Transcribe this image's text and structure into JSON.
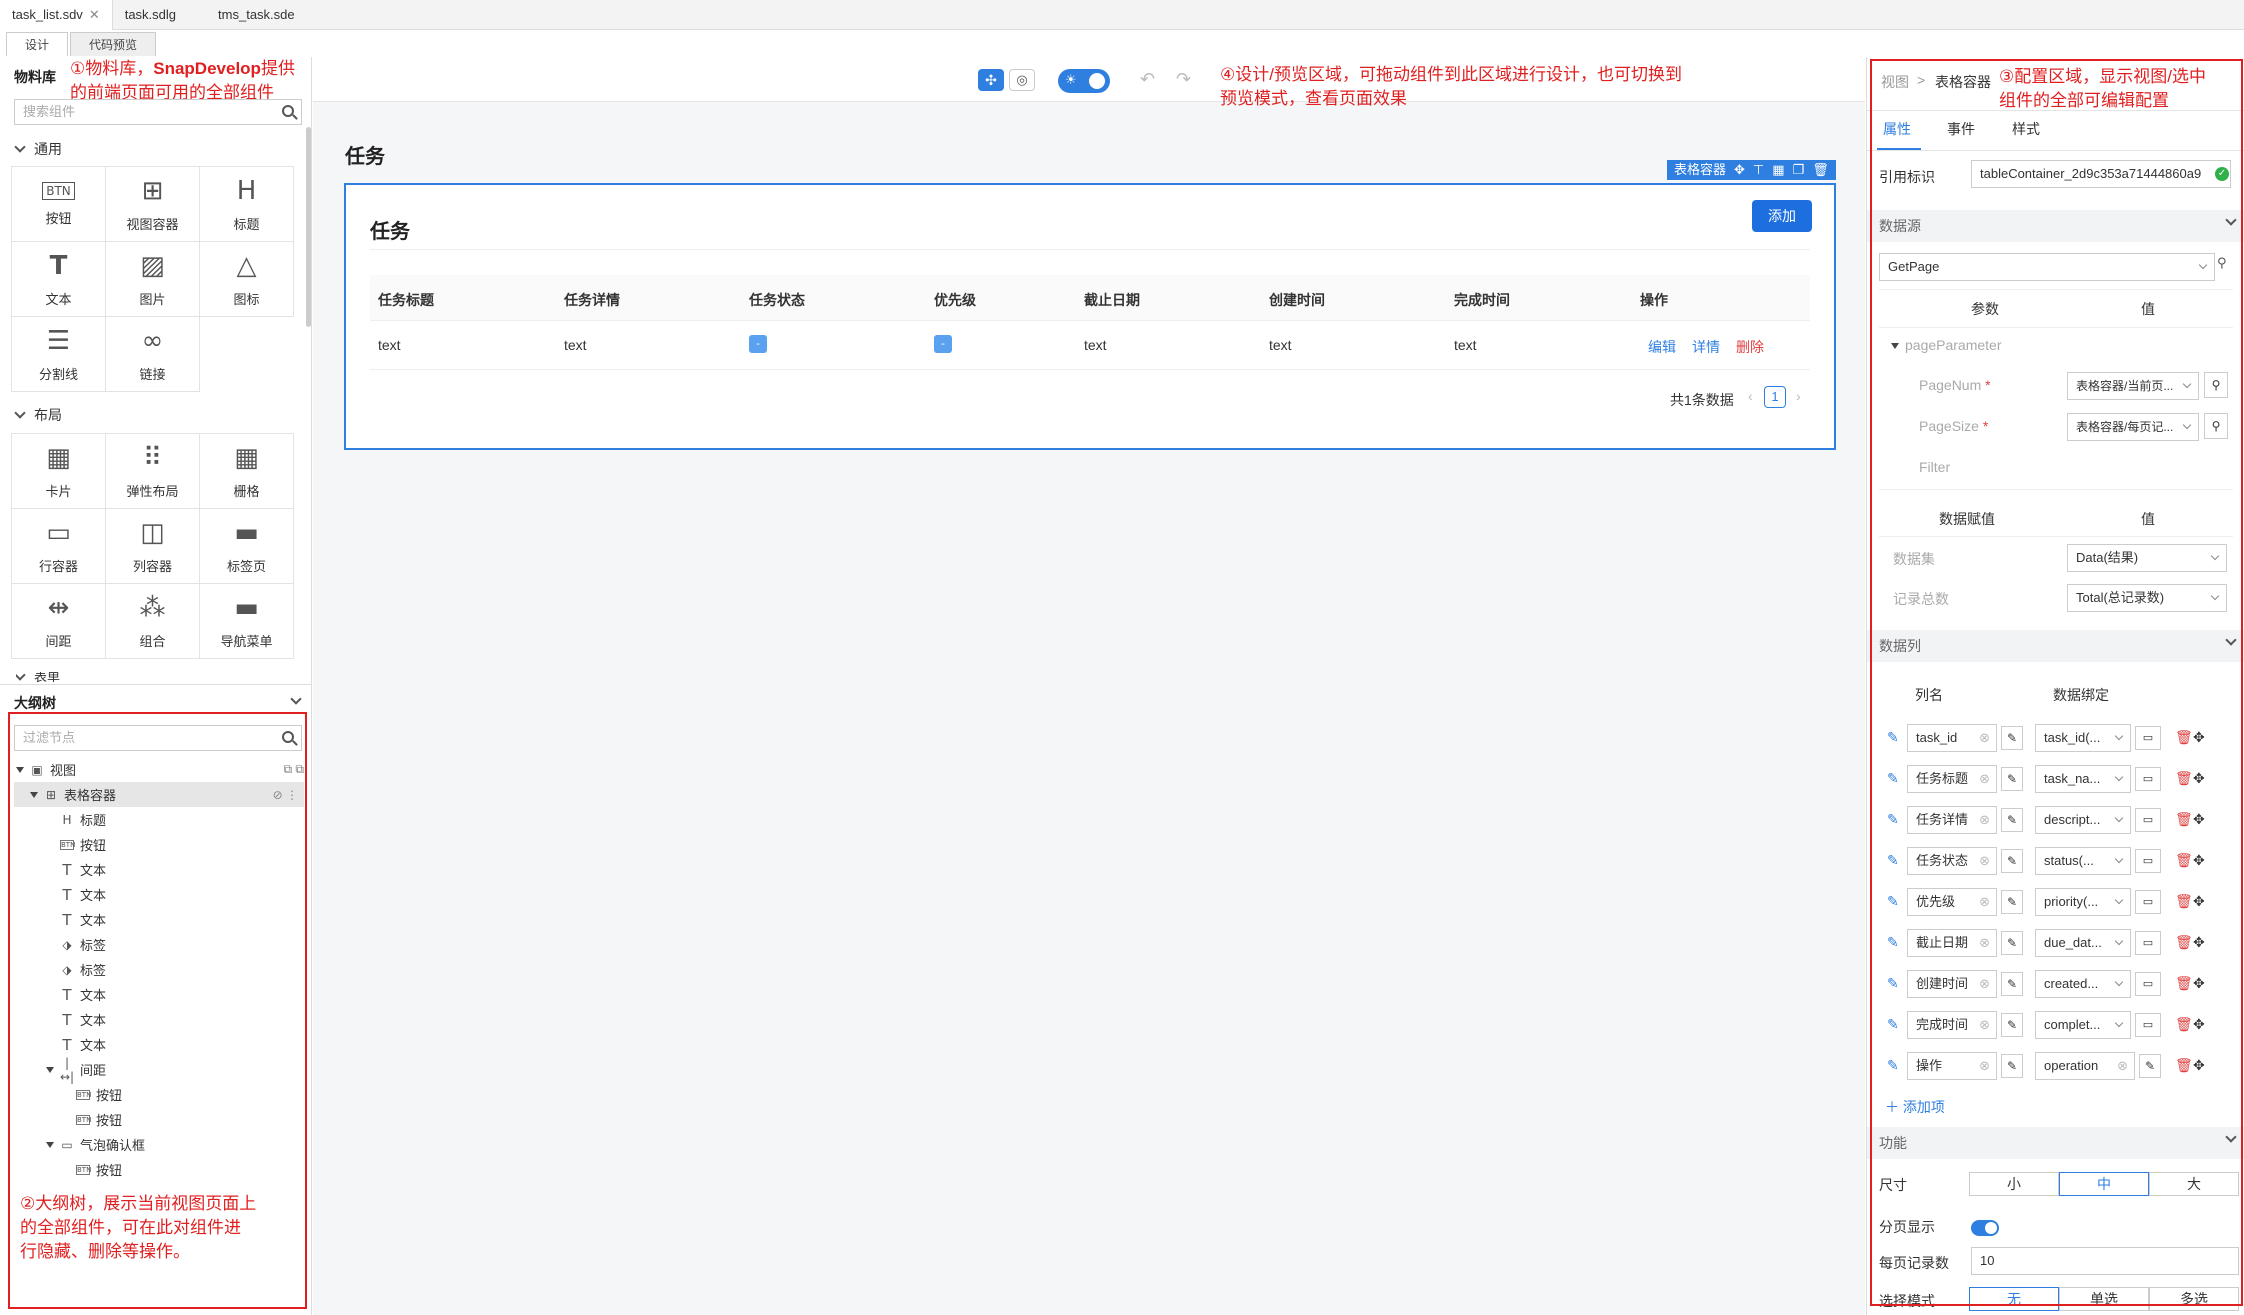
{
  "file_tabs": [
    {
      "label": "task_list.sdv",
      "active": true
    },
    {
      "label": "task.sdlg",
      "active": false
    },
    {
      "label": "tms_task.sde",
      "active": false
    }
  ],
  "mode_tabs": [
    {
      "label": "设计"
    },
    {
      "label": "代码预览"
    }
  ],
  "left": {
    "library_title": "物料库",
    "search_placeholder": "搜索组件",
    "groups": {
      "common": {
        "label": "通用",
        "items": [
          "按钮",
          "视图容器",
          "标题",
          "文本",
          "图片",
          "图标",
          "分割线",
          "链接"
        ]
      },
      "layout": {
        "label": "布局",
        "items": [
          "卡片",
          "弹性布局",
          "栅格",
          "行容器",
          "列容器",
          "标签页",
          "间距",
          "组合",
          "导航菜单"
        ]
      },
      "form": {
        "label": "表单"
      }
    },
    "outline_title": "大纲树",
    "outline_placeholder": "过滤节点",
    "tree": [
      {
        "label": "视图",
        "icon": "view",
        "depth": 0,
        "expand": true
      },
      {
        "label": "表格容器",
        "icon": "table",
        "depth": 1,
        "expand": true,
        "selected": true
      },
      {
        "label": "标题",
        "icon": "H",
        "depth": 2
      },
      {
        "label": "按钮",
        "icon": "BTN",
        "depth": 2
      },
      {
        "label": "文本",
        "icon": "T",
        "depth": 2
      },
      {
        "label": "文本",
        "icon": "T",
        "depth": 2
      },
      {
        "label": "文本",
        "icon": "T",
        "depth": 2
      },
      {
        "label": "标签",
        "icon": "tag",
        "depth": 2
      },
      {
        "label": "标签",
        "icon": "tag",
        "depth": 2
      },
      {
        "label": "文本",
        "icon": "T",
        "depth": 2
      },
      {
        "label": "文本",
        "icon": "T",
        "depth": 2
      },
      {
        "label": "文本",
        "icon": "T",
        "depth": 2
      },
      {
        "label": "间距",
        "icon": "space",
        "depth": 2,
        "expand": true
      },
      {
        "label": "按钮",
        "icon": "BTN",
        "depth": 3
      },
      {
        "label": "按钮",
        "icon": "BTN",
        "depth": 3
      },
      {
        "label": "气泡确认框",
        "icon": "pop",
        "depth": 2,
        "expand": true
      },
      {
        "label": "按钮",
        "icon": "BTN",
        "depth": 3
      }
    ]
  },
  "annotations": {
    "a1_pre": "①物料库，",
    "a1_brand": "SnapDevelop",
    "a1_post": "提供",
    "a1_line2": "的前端页面可用的全部组件",
    "a2_line1": "②大纲树，展示当前视图页面上",
    "a2_line2": "的全部组件，可在此对组件进",
    "a2_line3": "行隐藏、删除等操作。",
    "a3_line1": "③配置区域，显示视图/选中",
    "a3_line2": "组件的全部可编辑配置",
    "a4_line1": "④设计/预览区域，可拖动组件到此区域进行设计，也可切换到",
    "a4_line2": "预览模式，查看页面效果"
  },
  "canvas": {
    "page_title": "任务",
    "container_tag": "表格容器",
    "card_title": "任务",
    "add_button": "添加",
    "columns": [
      "任务标题",
      "任务详情",
      "任务状态",
      "优先级",
      "截止日期",
      "创建时间",
      "完成时间",
      "操作"
    ],
    "row": {
      "title": "text",
      "detail": "text",
      "status": "-",
      "priority": "-",
      "due": "text",
      "created": "text",
      "done": "text"
    },
    "actions": {
      "edit": "编辑",
      "detail": "详情",
      "delete": "删除"
    },
    "total": "共1条数据",
    "page": "1"
  },
  "right": {
    "breadcrumb_root": "视图",
    "breadcrumb_sep": ">",
    "breadcrumb_current": "表格容器",
    "tabs": [
      "属性",
      "事件",
      "样式"
    ],
    "ref_label": "引用标识",
    "ref_value": "tableContainer_2d9c353a71444860a9",
    "datasource_title": "数据源",
    "datasource_value": "GetPage",
    "param_header": "参数",
    "value_header": "值",
    "param_group": "pageParameter",
    "params": [
      {
        "name": "PageNum",
        "value": "表格容器/当前页..."
      },
      {
        "name": "PageSize",
        "value": "表格容器/每页记..."
      },
      {
        "name": "Filter",
        "value": ""
      }
    ],
    "assign_header": "数据赋值",
    "assign_value_header": "值",
    "assigns": [
      {
        "name": "数据集",
        "value": "Data(结果)"
      },
      {
        "name": "记录总数",
        "value": "Total(总记录数)"
      }
    ],
    "columns_title": "数据列",
    "col_name_header": "列名",
    "col_bind_header": "数据绑定",
    "data_columns": [
      {
        "name": "task_id",
        "bind": "task_id(..."
      },
      {
        "name": "任务标题",
        "bind": "task_na..."
      },
      {
        "name": "任务详情",
        "bind": "descript..."
      },
      {
        "name": "任务状态",
        "bind": "status(..."
      },
      {
        "name": "优先级",
        "bind": "priority(..."
      },
      {
        "name": "截止日期",
        "bind": "due_dat..."
      },
      {
        "name": "创建时间",
        "bind": "created..."
      },
      {
        "name": "完成时间",
        "bind": "complet..."
      },
      {
        "name": "操作",
        "bind": "operation"
      }
    ],
    "add_item": "添加项",
    "feature_title": "功能",
    "size_label": "尺寸",
    "sizes": [
      "小",
      "中",
      "大"
    ],
    "paging_label": "分页显示",
    "pagesize_label": "每页记录数",
    "pagesize_value": "10",
    "select_label": "选择模式",
    "select_modes": [
      "无",
      "单选",
      "多选"
    ]
  },
  "colors": {
    "accent": "#2f7fe0",
    "annotation": "#e02020"
  }
}
